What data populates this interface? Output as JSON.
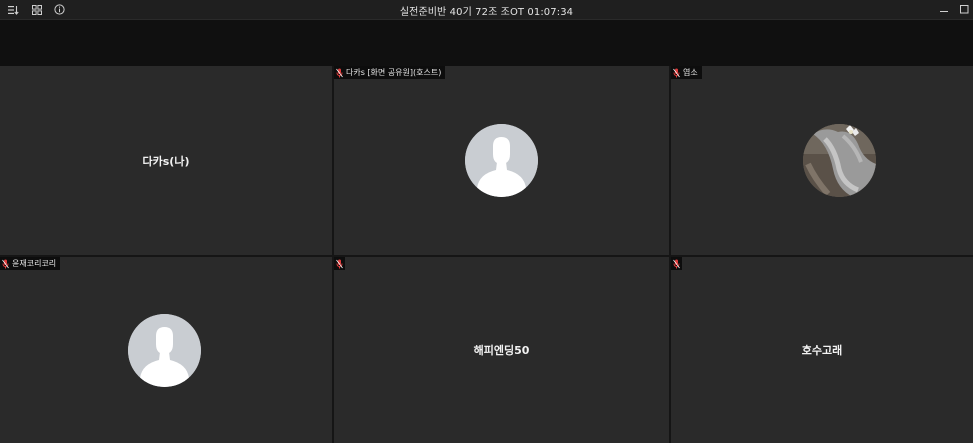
{
  "window": {
    "title": "실전준비반 40기 72조 조OT 01:07:34"
  },
  "toolbar": {
    "icons": [
      "sort-icon",
      "grid-view-icon",
      "info-icon"
    ]
  },
  "colors": {
    "tile_bg": "#2a2a2a",
    "mic_muted": "#e03b3b",
    "avatar_bg": "#c9cdd2"
  },
  "participants": [
    {
      "name": "다카s(나)",
      "label": ""
    },
    {
      "name": "",
      "label": "다카s [화면 공유원](호스트)"
    },
    {
      "name": "",
      "label": "염소"
    },
    {
      "name": "",
      "label": "윤재코리코리"
    },
    {
      "name": "해피엔딩50",
      "label": ""
    },
    {
      "name": "호수고래",
      "label": ""
    }
  ]
}
